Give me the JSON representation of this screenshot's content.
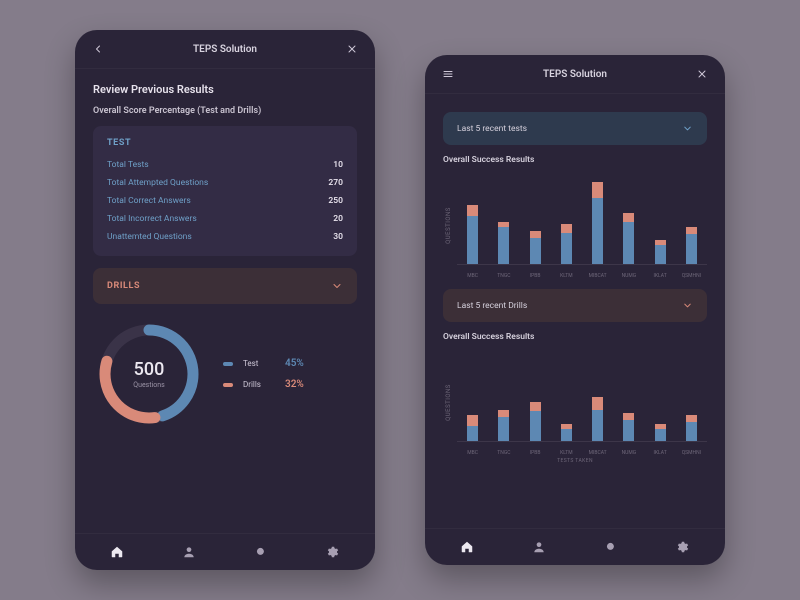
{
  "colors": {
    "blue": "#5d88b3",
    "orange": "#d98a79"
  },
  "left": {
    "title": "TEPS Solution",
    "heading": "Review Previous Results",
    "subheading": "Overall Score Percentage (Test and Drills)",
    "test_card": {
      "title": "TEST",
      "rows": [
        {
          "k": "Total Tests",
          "v": "10"
        },
        {
          "k": "Total Attempted Questions",
          "v": "270"
        },
        {
          "k": "Total Correct Answers",
          "v": "250"
        },
        {
          "k": "Total Incorrect Answers",
          "v": "20"
        },
        {
          "k": "Unattemted Questions",
          "v": "30"
        }
      ]
    },
    "drills_label": "DRILLS",
    "donut": {
      "number": "500",
      "caption": "Questions"
    },
    "legend": [
      {
        "name": "Test",
        "pct": "45%",
        "color": "#5d88b3"
      },
      {
        "name": "Drills",
        "pct": "32%",
        "color": "#d98a79"
      }
    ]
  },
  "right": {
    "title": "TEPS Solution",
    "select_tests": "Last 5 recent tests",
    "select_drills": "Last 5 recent Drills",
    "section_title": "Overall Success Results",
    "yaxis": "QUESTIONS",
    "xtitle": "TESTS TAKEN"
  },
  "chart_data": [
    {
      "type": "bar",
      "title": "Overall Success Results",
      "ylabel": "QUESTIONS",
      "xlabel": "",
      "ylim": [
        0,
        100
      ],
      "categories": [
        "MBC",
        "TNGC",
        "IPBB",
        "KLTM",
        "MIBCAT",
        "NUMG",
        "IKLAT",
        "QSMHNI"
      ],
      "series": [
        {
          "name": "Test",
          "values": [
            55,
            42,
            30,
            36,
            74,
            48,
            22,
            34
          ]
        },
        {
          "name": "Drills",
          "values": [
            12,
            6,
            8,
            10,
            18,
            10,
            6,
            8
          ]
        }
      ]
    },
    {
      "type": "bar",
      "title": "Overall Success Results",
      "ylabel": "QUESTIONS",
      "xlabel": "TESTS TAKEN",
      "ylim": [
        0,
        100
      ],
      "categories": [
        "MBC",
        "TNGC",
        "IPBB",
        "KLTM",
        "MIBCAT",
        "NUMG",
        "IKLAT",
        "QSMHNI"
      ],
      "series": [
        {
          "name": "Test",
          "values": [
            18,
            28,
            34,
            14,
            36,
            24,
            14,
            22
          ]
        },
        {
          "name": "Drills",
          "values": [
            12,
            8,
            10,
            6,
            14,
            8,
            6,
            8
          ]
        }
      ]
    }
  ]
}
